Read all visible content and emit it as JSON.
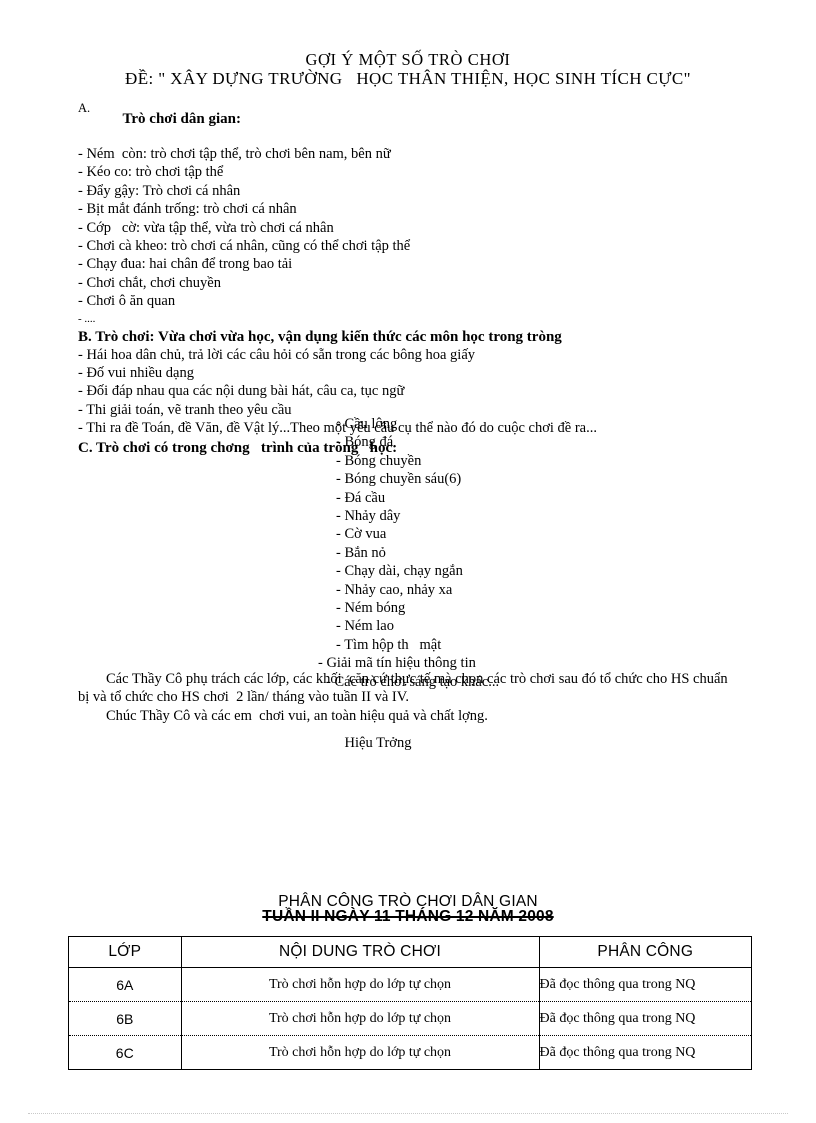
{
  "document": {
    "title_line1": "GỢI Ý MỘT SỐ TRÒ CHƠI",
    "title_line2": "ĐỀ: \" XÂY DỰNG TRƯỜNG   HỌC THÂN THIỆN, HỌC SINH TÍCH CỰC\""
  },
  "section_a": {
    "marker": "A.",
    "heading": "Trò chơi dân gian:",
    "items": [
      "- Ném  còn: trò chơi tập thể, trò chơi bên nam, bên nữ",
      "- Kéo co: trò chơi tập thể",
      "- Đẩy gậy: Trò chơi cá nhân",
      "- Bịt mắt đánh trống: trò chơi cá nhân",
      "- Cớp   cờ: vừa tập thể, vừa trò chơi cá nhân",
      "- Chơi cà kheo: trò chơi cá nhân, cũng có thể chơi tập thể",
      "- Chạy đua: hai chân để trong bao tải",
      "- Chơi chắt, chơi chuyền",
      "- Chơi ô ăn quan",
      "- ...."
    ]
  },
  "section_b": {
    "heading": "B. Trò chơi: Vừa chơi vừa học, vận dụng kiến thức các môn học trong tròng",
    "items": [
      "- Hái hoa dân chủ, trả lời các câu hỏi có sẵn trong các bông hoa giấy",
      "- Đố vui nhiều dạng",
      "- Đối đáp nhau qua các nội dung bài hát, câu ca, tục ngữ",
      "- Thi giải toán, vẽ tranh theo yêu cầu"
    ],
    "wrap_item": "- Thi ra đề Toán, đề Văn, đề Vật lý...Theo  một yêu cầu cụ thể nào đó do cuộc chơi đề ra..."
  },
  "section_c": {
    "heading": "C. Trò chơi có trong chơng   trình của tròng   học:",
    "items": [
      "- Cầu lông",
      "- Bóng đá",
      "- Bóng chuyền",
      "- Bóng chuyền sáu(6)",
      "- Đá cầu",
      "- Nhảy dây",
      "- Cờ vua",
      "- Bắn nỏ",
      "- Chạy dài, chạy ngắn",
      "- Nhảy cao, nhảy xa",
      "- Ném bóng",
      "- Ném lao",
      "- Tìm hộp th   mật"
    ],
    "items_outdent": [
      "- Giải mã tín hiệu thông tin",
      "- Các trò chơi sáng tạo khác..."
    ]
  },
  "closing": {
    "paragraph1": "Các Thầy Cô phụ trách các lớp, các khối  căn cứ thực tế mà chọn các trò chơi sau đó tổ chức cho HS chuẩn bị và tổ chức cho HS chơi  2 lần/ tháng vào tuần II và IV.",
    "paragraph2": "Chúc Thầy Cô và các em  chơi vui, an toàn hiệu quả và chất lợng.",
    "signature": "Hiệu Trởng"
  },
  "assignment_section": {
    "heading_line1": "PHÂN CÔNG TRÒ CHƠI DÂN GIAN",
    "heading_line2": "TUẦN II NGÀY 11 THÁNG 12 NĂM 2008",
    "table": {
      "headers": [
        "LỚP",
        "NỘI DUNG TRÒ CHƠI",
        "PHÂN CÔNG"
      ],
      "rows": [
        [
          "6A",
          "Trò chơi hỗn hợp do lớp tự chọn",
          "Đã đọc   thông qua trong NQ"
        ],
        [
          "6B",
          "Trò chơi hỗn hợp do lớp tự chọn",
          "Đã đọc   thông qua trong NQ"
        ],
        [
          "6C",
          "Trò chơi hỗn hợp do lớp tự chọn",
          "Đã đọc   thông qua trong NQ"
        ]
      ]
    }
  }
}
